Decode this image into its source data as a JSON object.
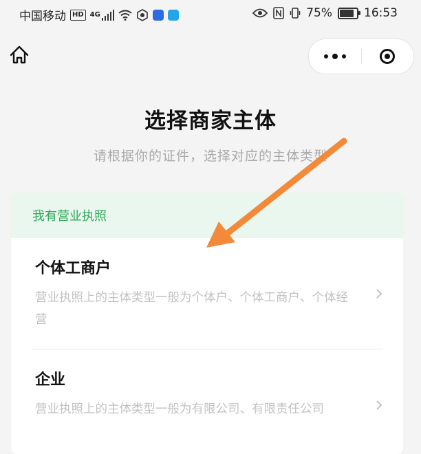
{
  "status_bar": {
    "carrier": "中国移动",
    "hd_tag": "HD",
    "net_tag": "4G",
    "battery_percent": "75%",
    "time": "16:53"
  },
  "page": {
    "title": "选择商家主体",
    "subtitle": "请根据你的证件，选择对应的主体类型"
  },
  "section": {
    "header": "我有营业执照",
    "options": [
      {
        "title": "个体工商户",
        "desc": "营业执照上的主体类型一般为个体户、个体工商户、个体经营"
      },
      {
        "title": "企业",
        "desc": "营业执照上的主体类型一般为有限公司、有限责任公司"
      }
    ]
  },
  "colors": {
    "accent_green": "#2fa85a",
    "header_bg": "#eaf7ee",
    "annotation_arrow": "#f28a3a"
  },
  "icons": [
    "home-icon",
    "more-icon",
    "close-target-icon",
    "chevron-right-icon"
  ]
}
